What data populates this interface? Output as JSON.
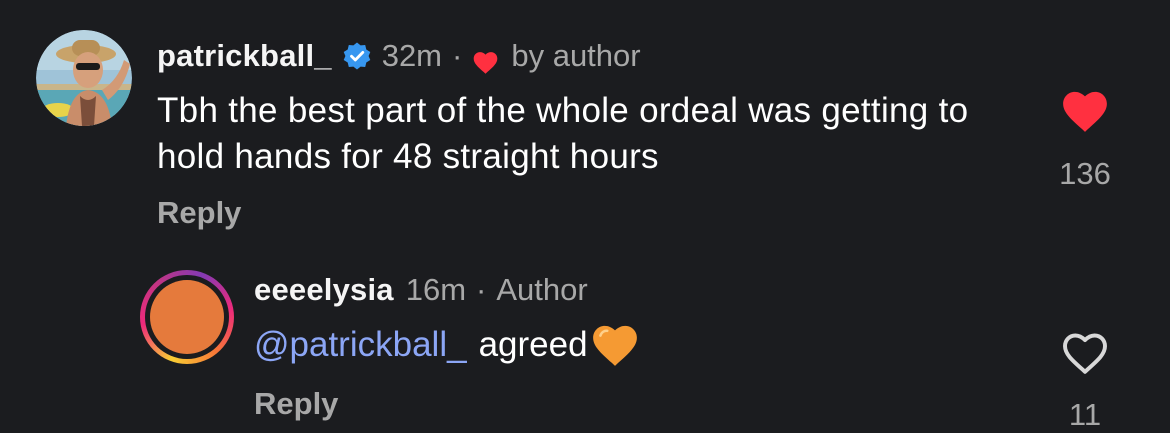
{
  "comments": [
    {
      "username": "patrickball_",
      "verified": true,
      "time": "32m",
      "separator": "·",
      "liked_by_author_label": "by author",
      "text": "Tbh the best part of the whole ordeal was getting to hold hands for 48 straight hours",
      "reply_label": "Reply",
      "likes": "136",
      "liked": true
    }
  ],
  "replies": [
    {
      "username": "eeeelysia",
      "time": "16m",
      "separator": "·",
      "role_label": "Author",
      "mention": "@patrickball_",
      "text": "agreed",
      "emoji": "orange-heart",
      "reply_label": "Reply",
      "likes": "11",
      "liked": false
    }
  ],
  "colors": {
    "background": "#1b1c1f",
    "like_red": "#ff3040",
    "verified_blue": "#3797f0",
    "mention_blue": "#8ca6f5",
    "secondary_text": "#a8a8a8",
    "avatar_orange": "#e57a3c",
    "emoji_orange": "#f59a33"
  }
}
